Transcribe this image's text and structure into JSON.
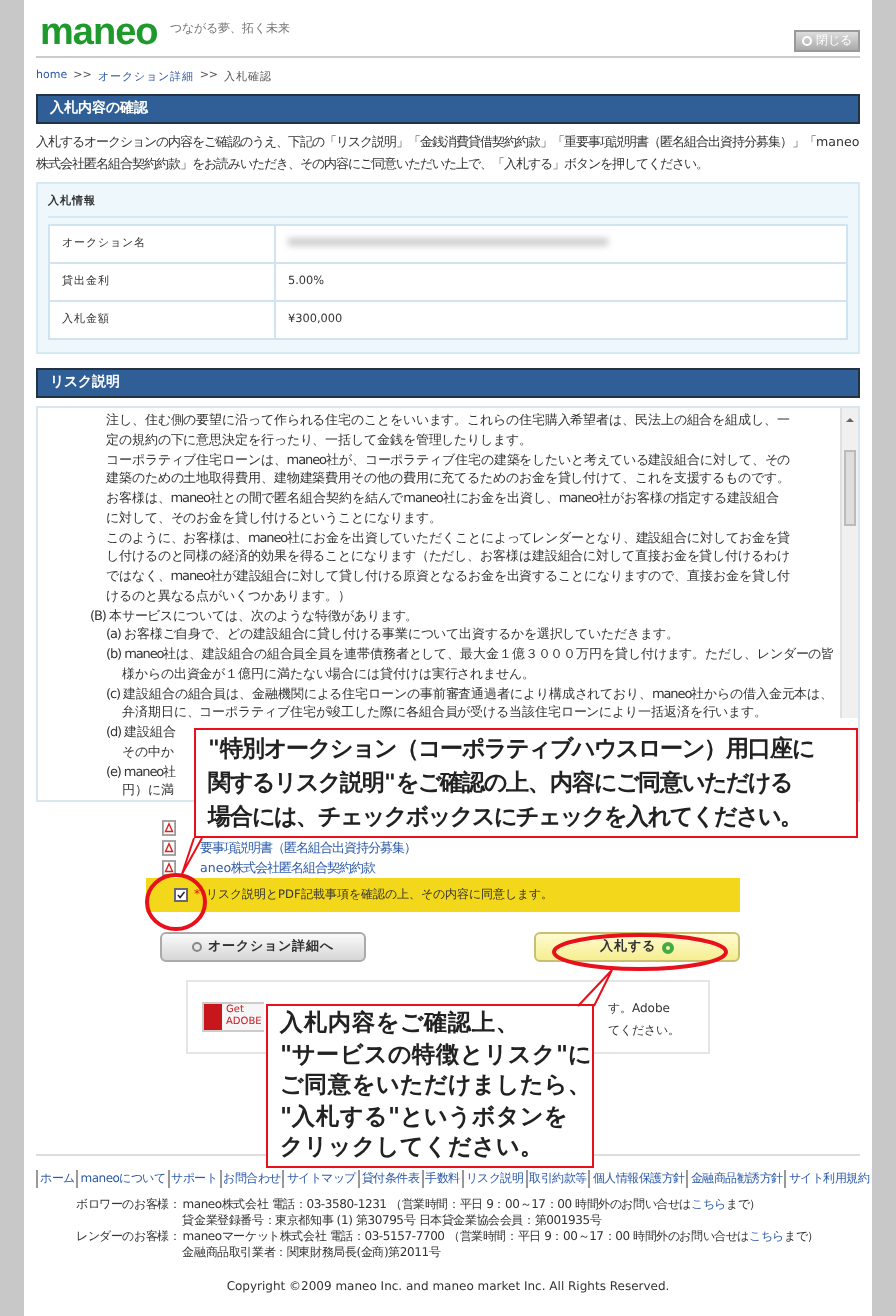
{
  "header": {
    "logo": "maneo",
    "tagline": "つながる夢、拓く未来",
    "close_button": "閉じる"
  },
  "breadcrumb": [
    {
      "kind": "link",
      "label": "home"
    },
    {
      "kind": "separator",
      "label": ">>"
    },
    {
      "kind": "link",
      "label": "オークション詳細"
    },
    {
      "kind": "separator",
      "label": ">>"
    },
    {
      "kind": "current",
      "label": "入札確認"
    }
  ],
  "confirm": {
    "title": "入札内容の確認",
    "intro": "入札するオークションの内容をご確認のうえ、下記の「リスク説明」「金銭消費貸借契約約款」「重要事項説明書（匿名組合出資持分募集）」「maneo株式会社匿名組合契約約款」をお読みいただき、その内容にご同意いただいた上で、「入札する」ボタンを押してください。",
    "info": {
      "title": "入札情報",
      "rows": [
        {
          "label": "オークション名",
          "kind": "redacted"
        },
        {
          "label": "貸出金利",
          "kind": "text",
          "value": "5.00%"
        },
        {
          "label": "入札金額",
          "kind": "text",
          "value": "¥300,000"
        }
      ]
    }
  },
  "risk": {
    "title": "リスク説明",
    "lines": [
      {
        "kind": "para",
        "text": "注し、住む側の要望に沿って作られる住宅のことをいいます。これらの住宅購入希望者は、民法上の組合を組成し、一"
      },
      {
        "kind": "para",
        "text": "定の規約の下に意思決定を行ったり、一括して金銭を管理したりします。"
      },
      {
        "kind": "para",
        "text": "コーポラティブ住宅ローンは、maneo社が、コーポラティブ住宅の建築をしたいと考えている建設組合に対して、その"
      },
      {
        "kind": "para",
        "text": "建築のための土地取得費用、建物建築費用その他の費用に充てるためのお金を貸し付けて、これを支援するものです。"
      },
      {
        "kind": "para",
        "text": "お客様は、maneo社との間で匿名組合契約を結んでmaneo社にお金を出資し、maneo社がお客様の指定する建設組合"
      },
      {
        "kind": "para",
        "text": "に対して、そのお金を貸し付けるということになります。"
      },
      {
        "kind": "para",
        "text": "このように、お客様は、maneo社にお金を出資していただくことによってレンダーとなり、建設組合に対してお金を貸"
      },
      {
        "kind": "para",
        "text": "し付けるのと同様の経済的効果を得ることになります（ただし、お客様は建設組合に対して直接お金を貸し付けるわけ"
      },
      {
        "kind": "para",
        "text": "ではなく、maneo社が建設組合に対して貸し付ける原資となるお金を出資することになりますので、直接お金を貸し付"
      },
      {
        "kind": "para",
        "text": "けるのと異なる点がいくつかあります。）"
      },
      {
        "kind": "heading",
        "text": "(B) 本サービスについては、次のような特徴があります。"
      },
      {
        "kind": "item",
        "text": "(a) お客様ご自身で、どの建設組合に貸し付ける事業について出資するかを選択していただきます。"
      },
      {
        "kind": "item",
        "text": "(b) maneo社は、建設組合の組合員全員を連帯債務者として、最大金１億３０００万円を貸し付けます。ただし、レンダーの皆"
      },
      {
        "kind": "cutcont",
        "text": "様からの出資金が１億円に満たない場合には貸付けは実行されません。"
      },
      {
        "kind": "item",
        "text": "(c) 建設組合の組合員は、金融機関による住宅ローンの事前審査通過者により構成されており、maneo社からの借入金元本は、"
      },
      {
        "kind": "cutcont",
        "text": "弁済期日に、コーポラティブ住宅が竣工した際に各組合員が受ける当該住宅ローンにより一括返済を行います。"
      },
      {
        "kind": "cut",
        "text": "(d) 建設組合"
      },
      {
        "kind": "cutcont",
        "text": "その中か"
      },
      {
        "kind": "cut",
        "text": "(e) maneo社"
      },
      {
        "kind": "cutcont",
        "text": "円）に満"
      }
    ]
  },
  "documents": [
    {
      "kind": "icon-only"
    },
    {
      "kind": "link",
      "label": "要事項説明書（匿名組合出資持分募集）"
    },
    {
      "kind": "link",
      "label": "aneo株式会社匿名組合契約約款"
    }
  ],
  "agreement": {
    "required_mark": "*",
    "label": "リスク説明とPDF記載事項を確認の上、その内容に同意します。",
    "checked": true
  },
  "buttons": [
    {
      "kind": "back",
      "label": "オークション詳細へ"
    },
    {
      "kind": "primary",
      "label": "入札する"
    }
  ],
  "adobe": {
    "badge": [
      "Get",
      "ADOBE"
    ],
    "lines": [
      "す。Adobe",
      "てください。"
    ]
  },
  "callouts": [
    {
      "lines": [
        "\"特別オークション（コーポラティブハウスローン）用口座に",
        "関するリスク説明\"をご確認の上、内容にご同意いただける",
        "場合には、チェックボックスにチェックを入れてください。"
      ]
    },
    {
      "lines": [
        "入札内容をご確認上、",
        "\"サービスの特徴とリスク\"に",
        "ご同意をいただけましたら、",
        "\"入札する\"というボタンを",
        "クリックしてください。"
      ]
    }
  ],
  "footer": {
    "links": [
      "ホーム",
      "maneoについて",
      "サポート",
      "お問合わせ",
      "サイトマップ",
      "貸付条件表",
      "手数料",
      "リスク説明",
      "取引約款等",
      "個人情報保護方針",
      "金融商品勧誘方針",
      "サイト利用規約"
    ],
    "contacts": [
      {
        "label": "ボロワーのお客様：",
        "text": "maneo株式会社 電話：03-3580-1231 （営業時間：平日 9：00～17：00 時間外のお問い合せは",
        "link": "こちら",
        "after": "まで）",
        "note": "貸金業登録番号：東京都知事 (1) 第30795号 日本貸金業協会会員：第001935号"
      },
      {
        "label": "レンダーのお客様：",
        "text": "maneoマーケット株式会社 電話：03-5157-7700 （営業時間：平日 9：00～17：00 時間外のお問い合せは",
        "link": "こちら",
        "after": "まで）",
        "note": "金融商品取引業者：関東財務局長(金商)第2011号"
      }
    ],
    "copyright": "Copyright ©2009 maneo Inc. and maneo market Inc. All Rights Reserved."
  }
}
